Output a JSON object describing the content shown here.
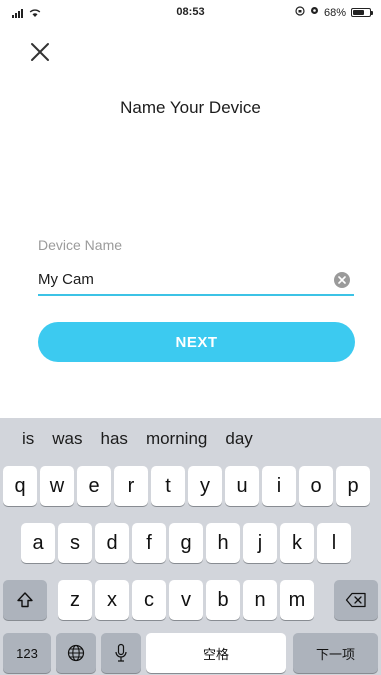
{
  "status_bar": {
    "time": "08:53",
    "battery_percent": "68%",
    "battery_level": 0.68
  },
  "header": {
    "close_icon": "close-icon",
    "title": "Name Your Device"
  },
  "form": {
    "label": "Device Name",
    "value": "My Cam",
    "clear_icon": "clear-input-icon"
  },
  "next_button": {
    "label": "NEXT",
    "color": "#3ccaf0"
  },
  "keyboard": {
    "suggestions": [
      "is",
      "was",
      "has",
      "morning",
      "day"
    ],
    "row1": [
      "q",
      "w",
      "e",
      "r",
      "t",
      "y",
      "u",
      "i",
      "o",
      "p"
    ],
    "row2": [
      "a",
      "s",
      "d",
      "f",
      "g",
      "h",
      "j",
      "k",
      "l"
    ],
    "row3": [
      "z",
      "x",
      "c",
      "v",
      "b",
      "n",
      "m"
    ],
    "numbers_label": "123",
    "space_label": "空格",
    "next_label": "下一项"
  }
}
